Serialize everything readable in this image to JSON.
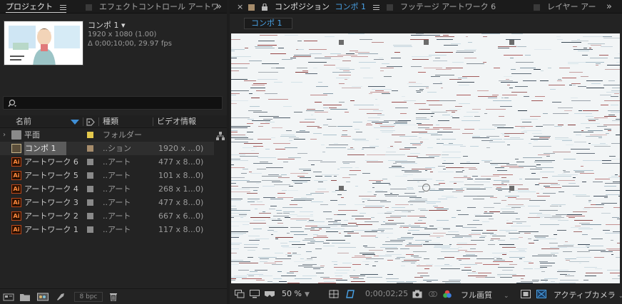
{
  "project_panel": {
    "tab_project": "プロジェクト",
    "tab_effect_controls": "エフェクトコントロール アートワ",
    "selected_item": {
      "name": "コンポ 1",
      "dimensions": "1920 x 1080 (1.00)",
      "duration": "Δ 0;00;10;00, 29.97 fps"
    },
    "search": {
      "placeholder": ""
    },
    "columns": {
      "name": "名前",
      "type": "種類",
      "video_info": "ビデオ情報"
    },
    "rows": [
      {
        "name": "平面",
        "type": "フォルダー",
        "video": "",
        "kind": "folder",
        "label_color": "#e3c84c"
      },
      {
        "name": "コンポ 1",
        "type": "..ション",
        "video": "1920 x ...0)",
        "kind": "comp",
        "label_color": "#a68c6b",
        "selected": true
      },
      {
        "name": "アートワーク 6",
        "type": "..アート",
        "video": "477 x 8...0)",
        "kind": "ai",
        "label_color": "#8a8a8a"
      },
      {
        "name": "アートワーク 5",
        "type": "..アート",
        "video": "101 x 8...0)",
        "kind": "ai",
        "label_color": "#8a8a8a"
      },
      {
        "name": "アートワーク 4",
        "type": "..アート",
        "video": "268 x 1...0)",
        "kind": "ai",
        "label_color": "#8a8a8a"
      },
      {
        "name": "アートワーク 3",
        "type": "..アート",
        "video": "477 x 8...0)",
        "kind": "ai",
        "label_color": "#8a8a8a"
      },
      {
        "name": "アートワーク 2",
        "type": "..アート",
        "video": "667 x 6...0)",
        "kind": "ai",
        "label_color": "#8a8a8a"
      },
      {
        "name": "アートワーク 1",
        "type": "..アート",
        "video": "117 x 8...0)",
        "kind": "ai",
        "label_color": "#8a8a8a"
      }
    ],
    "footer": {
      "bpc": "8 bpc"
    }
  },
  "comp_panel": {
    "tab_composition": "コンポジション",
    "tab_composition_name": "コンポ 1",
    "tab_footage": "フッテージ アートワーク 6",
    "tab_layer": "レイヤー アー",
    "comp_chip": "コンポ 1",
    "bottombar": {
      "zoom": "50 %",
      "timecode": "0;00;02;25",
      "resolution": "フル画質",
      "camera": "アクティブカメラ"
    }
  },
  "colors": {
    "accent_blue": "#4aa3e8",
    "panel_bg": "#232323",
    "dark_bg": "#1d1d1d"
  }
}
